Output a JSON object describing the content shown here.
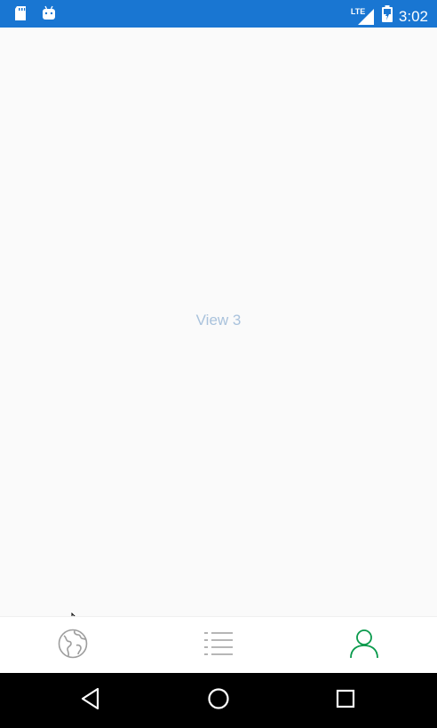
{
  "status_bar": {
    "time": "3:02",
    "network_label": "LTE",
    "left_icons": [
      "sd-card-icon",
      "android-icon"
    ],
    "right_icons": [
      "signal-icon",
      "battery-icon"
    ],
    "color": "#1976d2"
  },
  "content": {
    "view_label": "View 3"
  },
  "tab_bar": {
    "tabs": [
      {
        "icon": "globe-icon",
        "selected": false
      },
      {
        "icon": "list-icon",
        "selected": false
      },
      {
        "icon": "person-icon",
        "selected": true
      }
    ],
    "active_color": "#0a9a4c",
    "inactive_color": "#9e9e9e"
  },
  "nav_bar": {
    "buttons": [
      "back-icon",
      "home-icon",
      "recents-icon"
    ]
  }
}
